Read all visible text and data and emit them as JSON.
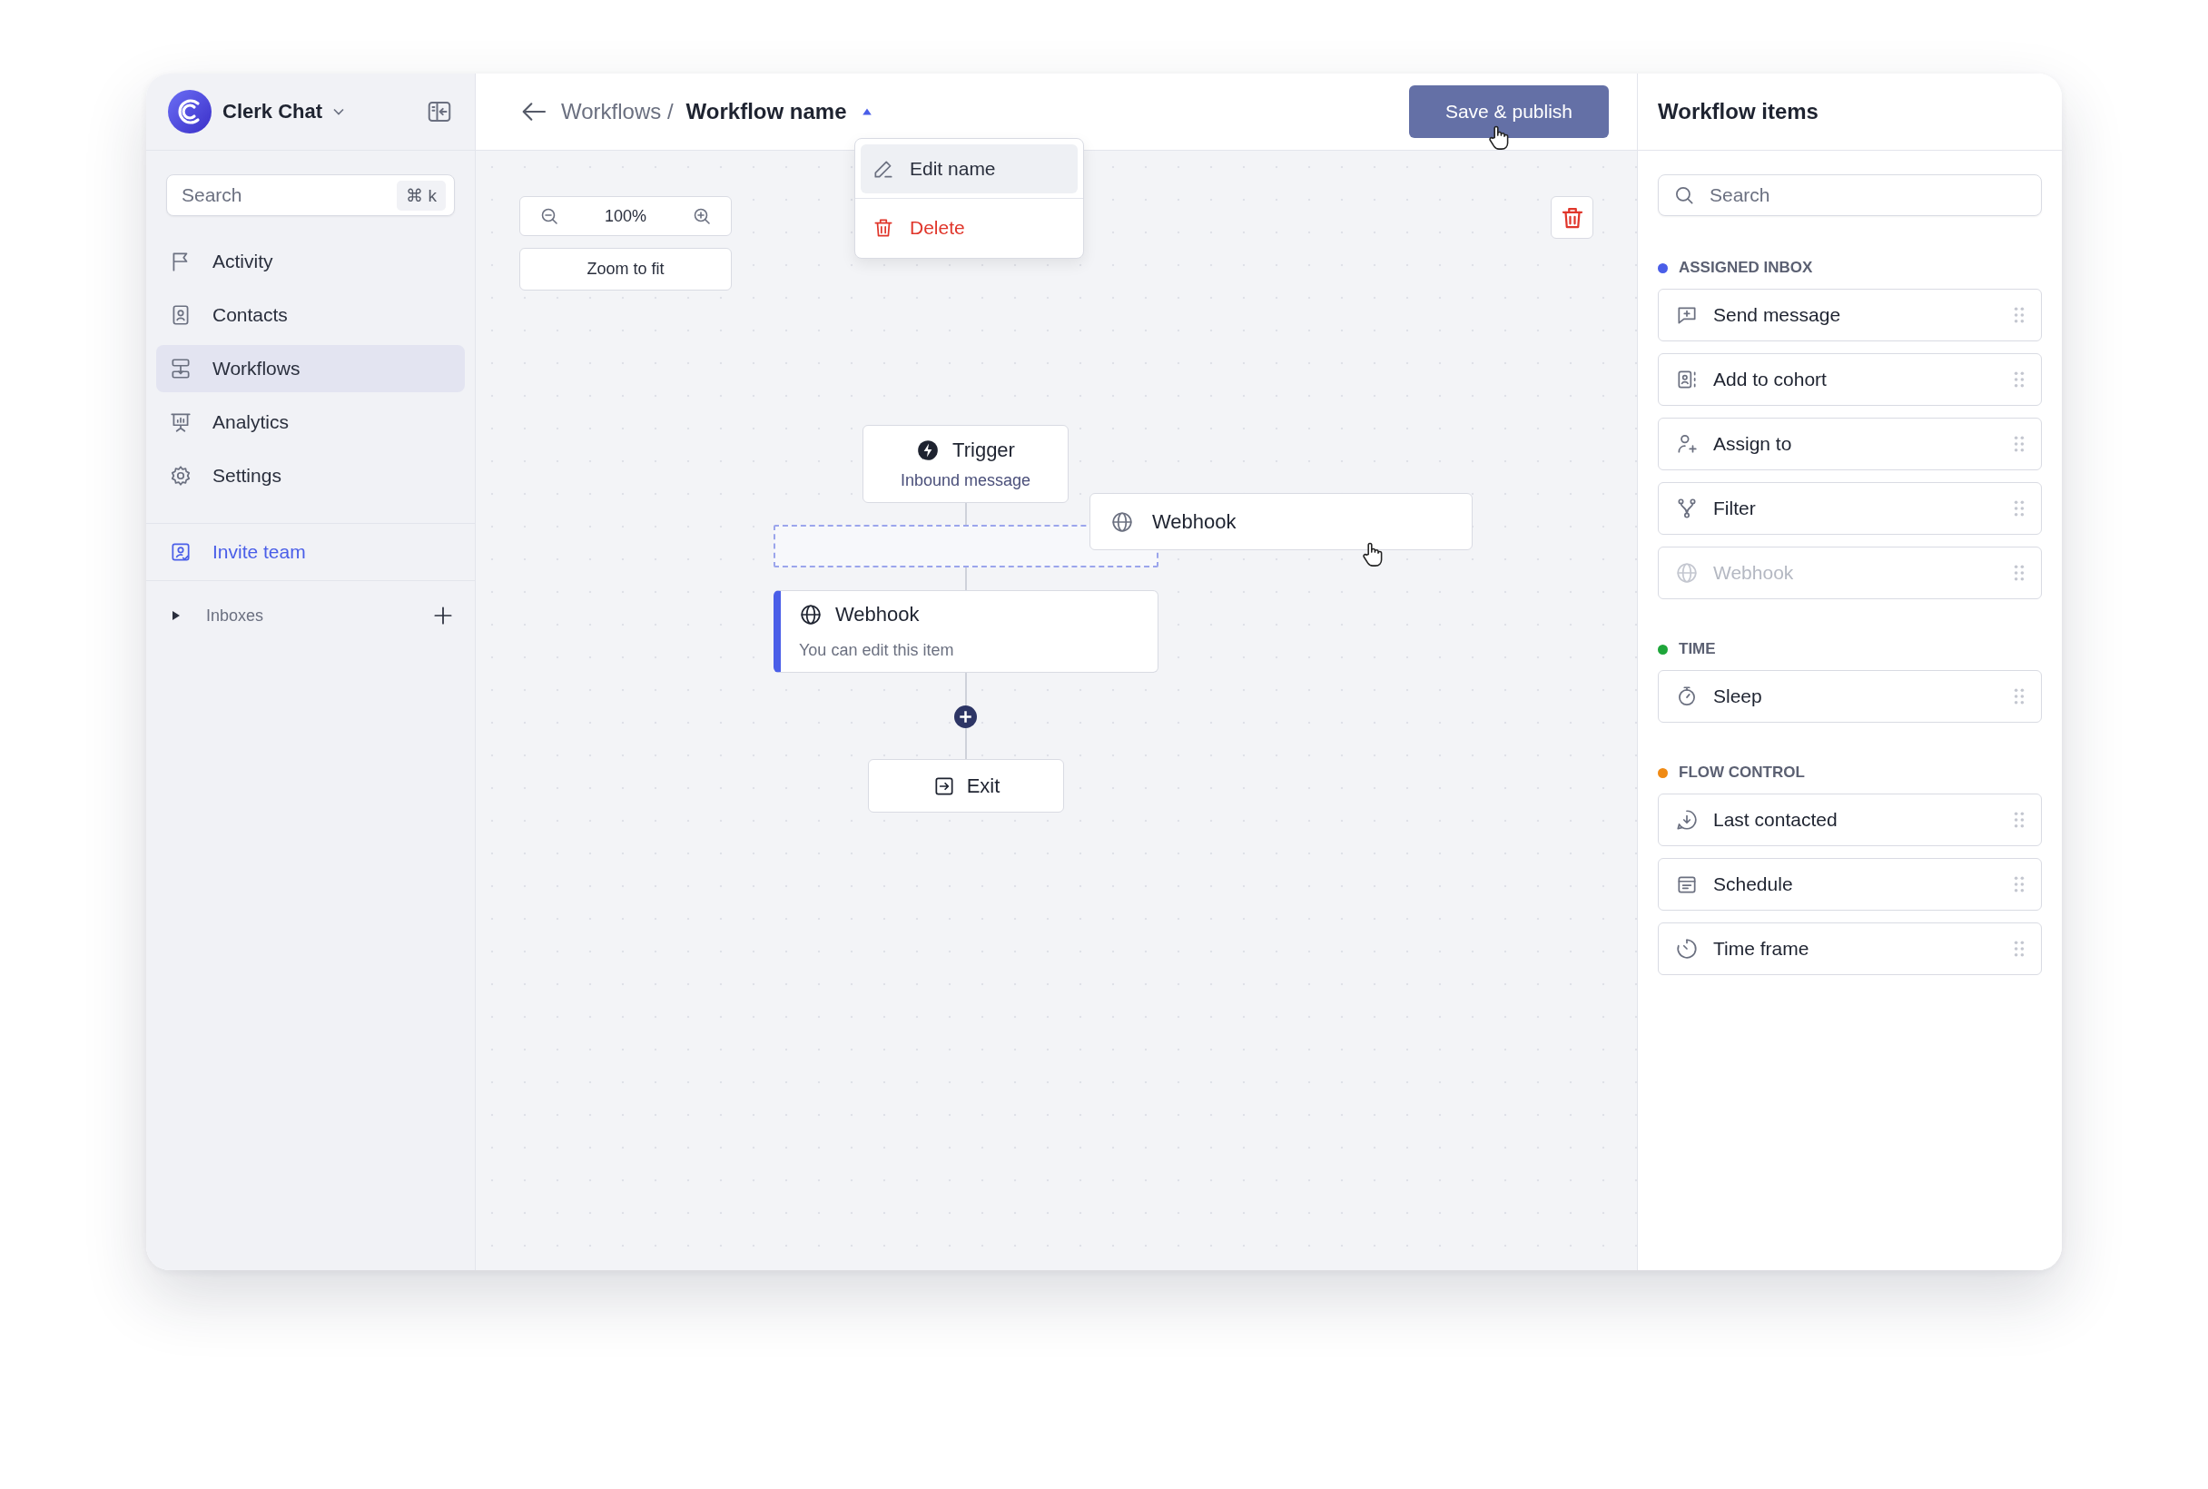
{
  "sidebar": {
    "workspace": "Clerk Chat",
    "search": {
      "placeholder": "Search",
      "shortcut": "⌘ k"
    },
    "nav": [
      {
        "label": "Activity",
        "selected": false
      },
      {
        "label": "Contacts",
        "selected": false
      },
      {
        "label": "Workflows",
        "selected": true
      },
      {
        "label": "Analytics",
        "selected": false
      },
      {
        "label": "Settings",
        "selected": false
      }
    ],
    "invite": "Invite team",
    "inboxes": {
      "label": "Inboxes",
      "expanded": false
    }
  },
  "header": {
    "breadcrumb": "Workflows /",
    "title": "Workflow name",
    "menu_open": true,
    "save_button": "Save & publish"
  },
  "name_menu": [
    {
      "label": "Edit name",
      "kind": "edit",
      "highlighted": true
    },
    {
      "label": "Delete",
      "kind": "delete",
      "highlighted": false
    }
  ],
  "canvas": {
    "zoom": "100%",
    "zoom_to_fit": "Zoom to fit",
    "nodes": [
      {
        "kind": "trigger",
        "title": "Trigger",
        "subtitle": "Inbound message"
      },
      {
        "kind": "drop_slot"
      },
      {
        "kind": "step",
        "title": "Webhook",
        "subtitle": "You can edit this item",
        "selected": true
      },
      {
        "kind": "add"
      },
      {
        "kind": "exit",
        "title": "Exit"
      },
      {
        "kind": "dragging",
        "title": "Webhook"
      }
    ]
  },
  "panel": {
    "title": "Workflow items",
    "search": {
      "placeholder": "Search"
    },
    "sections": [
      {
        "title": "ASSIGNED INBOX",
        "color": "#4a5ee8",
        "items": [
          {
            "label": "Send message",
            "disabled": false
          },
          {
            "label": "Add to cohort",
            "disabled": false
          },
          {
            "label": "Assign to",
            "disabled": false
          },
          {
            "label": "Filter",
            "disabled": false
          },
          {
            "label": "Webhook",
            "disabled": true
          }
        ]
      },
      {
        "title": "TIME",
        "color": "#1ea63a",
        "items": [
          {
            "label": "Sleep",
            "disabled": false
          }
        ]
      },
      {
        "title": "FLOW CONTROL",
        "color": "#f08a14",
        "items": [
          {
            "label": "Last contacted",
            "disabled": false
          },
          {
            "label": "Schedule",
            "disabled": false
          },
          {
            "label": "Time frame",
            "disabled": false
          }
        ]
      }
    ]
  }
}
